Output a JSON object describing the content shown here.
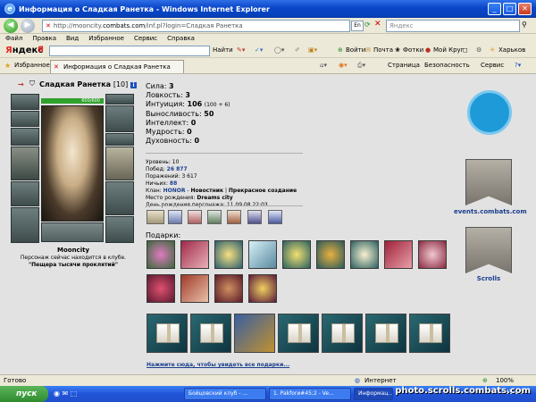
{
  "window": {
    "title": "Информация о Сладкая Ранетка - Windows Internet Explorer"
  },
  "address": {
    "prefix": "http://mooncity.",
    "domain": "combats.com",
    "suffix": "/inf.pl?login=Сладкая Ранетка",
    "lang": "En"
  },
  "search": {
    "placeholder": "Яндекс"
  },
  "menu": [
    "Файл",
    "Правка",
    "Вид",
    "Избранное",
    "Сервис",
    "Справка"
  ],
  "yandex_bar": {
    "logo_first": "Я",
    "logo_rest": "ндекс",
    "input_label": "Я",
    "find": "Найти",
    "login": "Войти",
    "mail": "Почта",
    "photos": "Фотки",
    "mycircle": "Мой Круг",
    "city": "Харьков"
  },
  "favorites": {
    "label": "Избранное",
    "tab_title": "Информация о Сладкая Ранетка",
    "page": "Страница",
    "security": "Безопасность",
    "service": "Сервис"
  },
  "character": {
    "name": "Сладкая Ранетка",
    "level": "[10]",
    "info_icon": "i",
    "hp": "600/600",
    "city": "Mooncity",
    "location_text": "Персонаж сейчас находится в клубе.",
    "location_name": "\"Пещера тысячи проклятий\""
  },
  "stats": [
    {
      "label": "Сила:",
      "value": "3",
      "extra": ""
    },
    {
      "label": "Ловкость:",
      "value": "3",
      "extra": ""
    },
    {
      "label": "Интуиция:",
      "value": "106",
      "extra": "(100 + 6)"
    },
    {
      "label": "Выносливость:",
      "value": "50",
      "extra": ""
    },
    {
      "label": "Интеллект:",
      "value": "0",
      "extra": ""
    },
    {
      "label": "Мудрость:",
      "value": "0",
      "extra": ""
    },
    {
      "label": "Духовность:",
      "value": "0",
      "extra": ""
    }
  ],
  "details": {
    "level_l": "Уровень:",
    "level_v": "10",
    "wins_l": "Побед:",
    "wins_v": "26 877",
    "losses_l": "Поражений:",
    "losses_v": "3 617",
    "draws_l": "Ничьих:",
    "draws_v": "88",
    "clan_l": "Клан:",
    "clan_v": "HONOR",
    "clan_dash": " - ",
    "clan_rank": "Новостник",
    "clan_sep": " | ",
    "clan_title": "Прекрасное создание",
    "birthplace_l": "Место рождения:",
    "birthplace_v": "Dreams city",
    "birthday_l": "День рождения персонажа:",
    "birthday_v": "11.09.08 22:03"
  },
  "gifts": {
    "label": "Подарки:",
    "more_link": "Нажмите сюда, чтобы увидеть все подарки..."
  },
  "right_panel": {
    "events": "events.combats.com",
    "scrolls": "Scrolls",
    "scrolls_banner": "scrolls",
    "events_banner": "events"
  },
  "statusbar": {
    "left": "Готово",
    "zone": "Интернет",
    "zoom": "100%"
  },
  "taskbar": {
    "start": "пуск",
    "tasks": [
      "Бойцовский клуб - ...",
      "1. Pakforи#45;2 - Ve...",
      "Информац..."
    ],
    "clock": "23:26"
  },
  "watermark": "photo.scrolls.combats.com",
  "colors": {
    "title_blue": "#0A45C8",
    "link_blue": "#1A3E8C",
    "hp_green": "#2FA12C",
    "bg": "#E2E2E2"
  }
}
